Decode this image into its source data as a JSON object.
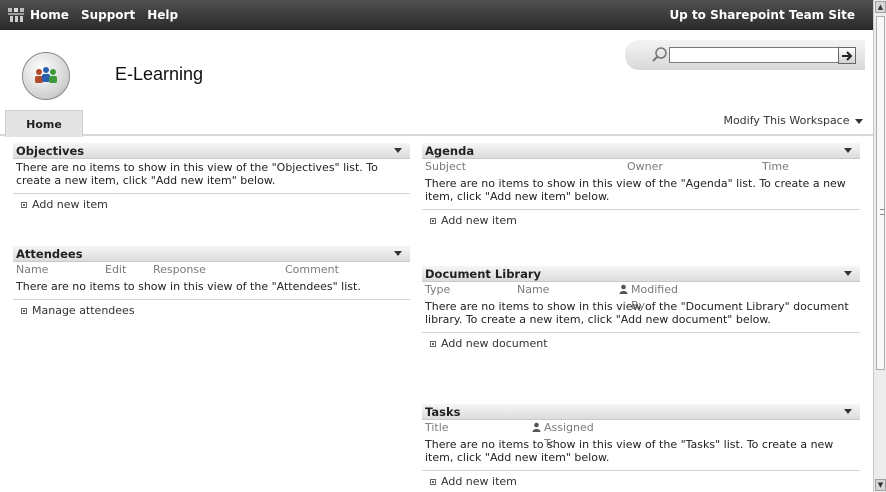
{
  "topbar": {
    "nav": [
      "Home",
      "Support",
      "Help"
    ],
    "up_link": "Up to Sharepoint Team Site"
  },
  "header": {
    "site_title": "E-Learning",
    "search_value": ""
  },
  "tabs": {
    "home": "Home",
    "modify": "Modify This Workspace"
  },
  "objectives": {
    "title": "Objectives",
    "message": "There are no items to show in this view of the \"Objectives\" list. To create a new item, click \"Add new item\" below.",
    "add": "Add new item"
  },
  "attendees": {
    "title": "Attendees",
    "columns": [
      "Name",
      "Edit",
      "Response",
      "Comment"
    ],
    "message": "There are no items to show in this view of the \"Attendees\" list.",
    "add": "Manage attendees"
  },
  "agenda": {
    "title": "Agenda",
    "columns": [
      "Subject",
      "Owner",
      "Time"
    ],
    "message": "There are no items to show in this view of the \"Agenda\" list. To create a new item, click \"Add new item\" below.",
    "add": "Add new item"
  },
  "doclib": {
    "title": "Document Library",
    "columns": [
      "Type",
      "Name",
      "Modified By"
    ],
    "message": "There are no items to show in this view of the \"Document Library\" document library. To create a new item, click \"Add new document\" below.",
    "add": "Add new document"
  },
  "tasks": {
    "title": "Tasks",
    "columns": [
      "Title",
      "Assigned To"
    ],
    "message": "There are no items to show in this view of the \"Tasks\" list. To create a new item, click \"Add new item\" below.",
    "add": "Add new item"
  },
  "colors": {
    "topbar": "#3a3a3a",
    "webpart_header": "#e4e4e4",
    "text": "#222222"
  }
}
